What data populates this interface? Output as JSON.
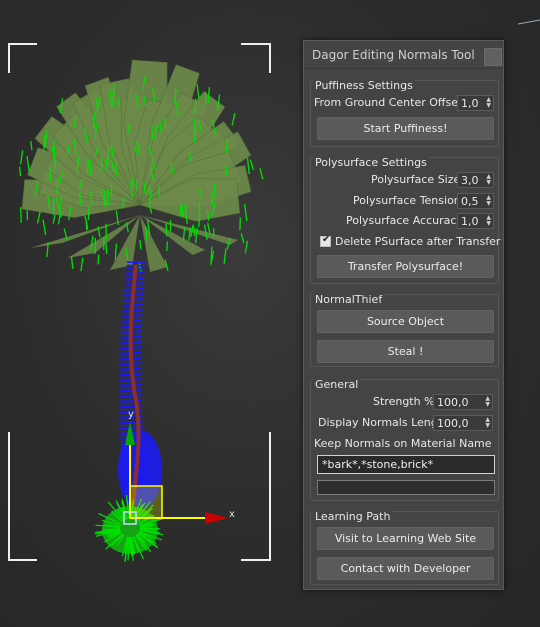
{
  "viewport": {
    "axis_labels": {
      "x": "x",
      "y": "y"
    },
    "colors": {
      "background": "#333333",
      "frond_fill": "#6d8a4a",
      "normals_green": "#00e000",
      "normals_blue": "#1a1aff",
      "trunk": "#7a2a2a",
      "gizmo_yellow": "#ffff00",
      "gizmo_red": "#cc0000",
      "gizmo_green": "#00aa00"
    }
  },
  "tool": {
    "title": "Dagor Editing Normals Tool",
    "close_icon": "close-icon",
    "puffiness": {
      "title": "Puffiness Settings",
      "offset_label": "From Ground Center Offset",
      "offset_value": "1,0",
      "start_button": "Start Puffiness!"
    },
    "polysurface": {
      "title": "Polysurface Settings",
      "size_label": "Polysurface Size",
      "size_value": "3,0",
      "tension_label": "Polysurface Tension",
      "tension_value": "0,5",
      "accuracy_label": "Polysurface Accuracy",
      "accuracy_value": "1,0",
      "delete_label": "Delete PSurface after Transfer",
      "delete_checked": true,
      "transfer_button": "Transfer Polysurface!"
    },
    "normalthief": {
      "title": "NormalThief",
      "source_button": "Source Object",
      "steal_button": "Steal !"
    },
    "general": {
      "title": "General",
      "strength_label": "Strength %",
      "strength_value": "100,0",
      "length_label": "Display Normals Length",
      "length_value": "100,0",
      "keep_label": "Keep Normals on Material Name",
      "keep_value": "*bark*,*stone,brick*",
      "progress": 0
    },
    "learning": {
      "title": "Learning Path",
      "visit_button": "Visit to Learning Web Site",
      "contact_button": "Contact with Developer"
    }
  }
}
